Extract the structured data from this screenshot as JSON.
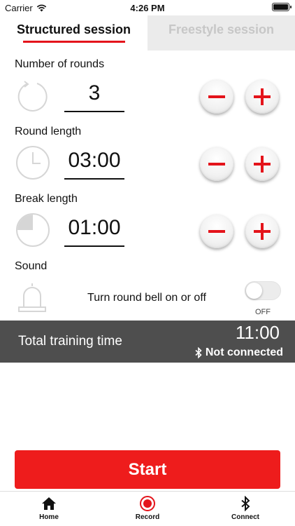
{
  "status_bar": {
    "carrier": "Carrier",
    "time": "4:26 PM"
  },
  "tabs": {
    "structured": "Structured session",
    "freestyle": "Freestyle session",
    "active": "structured"
  },
  "settings": {
    "rounds": {
      "label": "Number of rounds",
      "value": "3",
      "icon": "repeat-circle-icon"
    },
    "round_length": {
      "label": "Round length",
      "value": "03:00",
      "icon": "clock-icon"
    },
    "break_length": {
      "label": "Break length",
      "value": "01:00",
      "icon": "pie-timer-icon"
    },
    "sound": {
      "label": "Sound",
      "description": "Turn round bell on or off",
      "toggle_state": "OFF",
      "icon": "bell-icon"
    }
  },
  "summary": {
    "title": "Total training time",
    "total_time": "11:00",
    "connection_status": "Not connected"
  },
  "start_label": "Start",
  "tabbar": {
    "home": "Home",
    "record": "Record",
    "connect": "Connect"
  },
  "colors": {
    "accent_red": "#e4141b",
    "summary_bar": "#4e4e4e"
  }
}
